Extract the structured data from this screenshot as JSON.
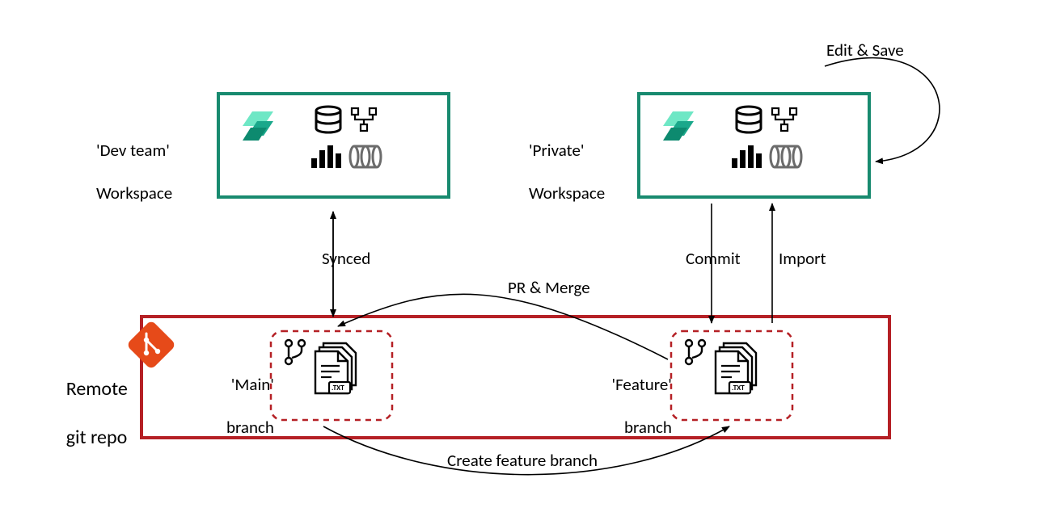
{
  "labels": {
    "dev_workspace_l1": "'Dev team'",
    "dev_workspace_l2": "Workspace",
    "private_workspace_l1": "'Private'",
    "private_workspace_l2": "Workspace",
    "remote_repo_l1": "Remote",
    "remote_repo_l2": "git repo",
    "main_branch_l1": "'Main'",
    "main_branch_l2": "branch",
    "feature_branch_l1": "'Feature'",
    "feature_branch_l2": "branch",
    "synced": "Synced",
    "commit": "Commit",
    "import": "Import",
    "edit_save": "Edit & Save",
    "pr_merge": "PR & Merge",
    "create_feature_branch": "Create feature branch",
    "file_ext": ".TXT"
  },
  "colors": {
    "workspace_border": "#188a6f",
    "repo_border": "#b52025",
    "branch_border": "#b52025",
    "git_badge": "#e64a19",
    "fabric_teal1": "#1aa88b",
    "fabric_teal2": "#0d8a6f",
    "arrow": "#000000"
  },
  "diagram": {
    "description": "Git workflow between two Fabric workspaces and a remote git repository",
    "nodes": [
      {
        "id": "dev_workspace",
        "type": "workspace",
        "label": "'Dev team' Workspace"
      },
      {
        "id": "private_workspace",
        "type": "workspace",
        "label": "'Private' Workspace"
      },
      {
        "id": "remote_repo",
        "type": "repo",
        "label": "Remote git repo"
      },
      {
        "id": "main_branch",
        "type": "branch",
        "parent": "remote_repo",
        "label": "'Main' branch"
      },
      {
        "id": "feature_branch",
        "type": "branch",
        "parent": "remote_repo",
        "label": "'Feature' branch"
      }
    ],
    "edges": [
      {
        "from": "dev_workspace",
        "to": "main_branch",
        "label": "Synced",
        "direction": "bidirectional"
      },
      {
        "from": "private_workspace",
        "to": "feature_branch",
        "label": "Commit",
        "direction": "down"
      },
      {
        "from": "feature_branch",
        "to": "private_workspace",
        "label": "Import",
        "direction": "up"
      },
      {
        "from": "private_workspace",
        "to": "private_workspace",
        "label": "Edit & Save",
        "direction": "self-loop"
      },
      {
        "from": "feature_branch",
        "to": "main_branch",
        "label": "PR & Merge",
        "direction": "curve"
      },
      {
        "from": "main_branch",
        "to": "feature_branch",
        "label": "Create feature branch",
        "direction": "curve"
      }
    ]
  }
}
